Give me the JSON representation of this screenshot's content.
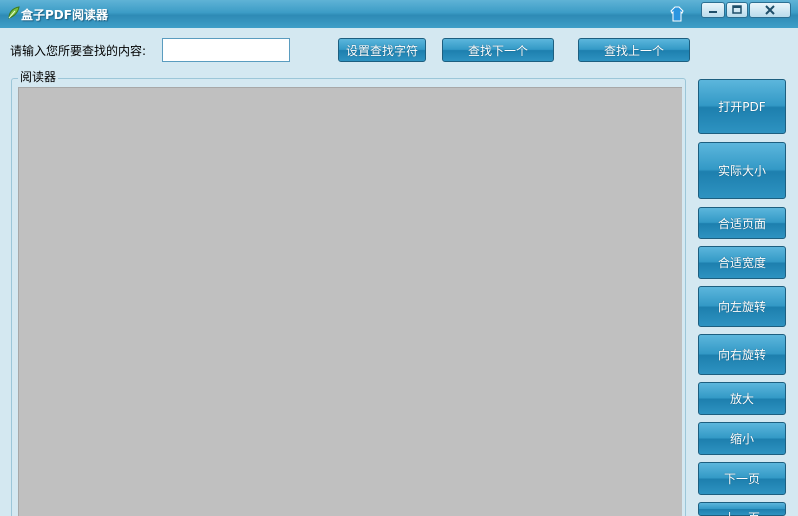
{
  "window": {
    "title": "盒子PDF阅读器",
    "accent_color": "#3c9cc6"
  },
  "titlebar_buttons": {
    "skin": "skin-icon",
    "minimize": "minimize-icon",
    "maximize": "maximize-icon",
    "close": "close-icon"
  },
  "search": {
    "label": "请输入您所要查找的内容:",
    "value": "",
    "set_button": "设置查找字符",
    "next_button": "查找下一个",
    "prev_button": "查找上一个"
  },
  "viewer": {
    "group_label": "阅读器",
    "background": "#c0c0c0"
  },
  "side_buttons": {
    "open_pdf": "打开PDF",
    "actual_size": "实际大小",
    "fit_page": "合适页面",
    "fit_width": "合适宽度",
    "rotate_left": "向左旋转",
    "rotate_right": "向右旋转",
    "zoom_in": "放大",
    "zoom_out": "缩小",
    "next_page": "下一页",
    "prev_page": "上一页"
  }
}
